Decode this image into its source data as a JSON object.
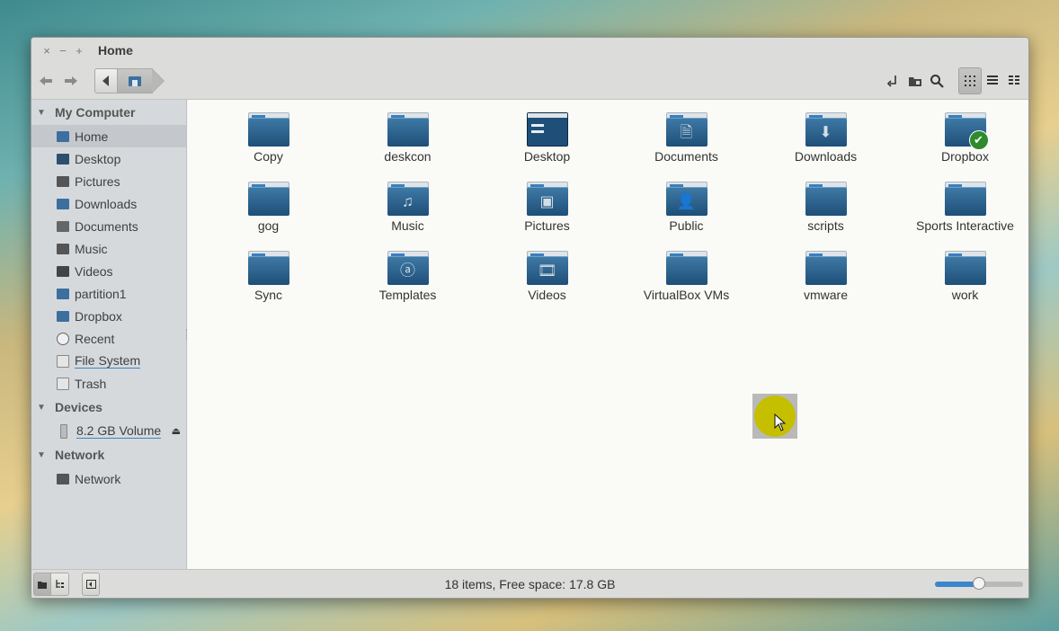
{
  "window": {
    "title": "Home"
  },
  "titlebar": {
    "close": "×",
    "minimize": "−",
    "maximize": "+"
  },
  "toolbar": {
    "back": "◀",
    "forward": "▶",
    "path_prev": "◀"
  },
  "sidebar": {
    "sections": [
      {
        "title": "My Computer",
        "items": [
          {
            "label": "Home",
            "icon": "home-icon",
            "selected": true
          },
          {
            "label": "Desktop",
            "icon": "desktop-icon"
          },
          {
            "label": "Pictures",
            "icon": "pictures-icon"
          },
          {
            "label": "Downloads",
            "icon": "downloads-icon"
          },
          {
            "label": "Documents",
            "icon": "documents-icon"
          },
          {
            "label": "Music",
            "icon": "music-icon"
          },
          {
            "label": "Videos",
            "icon": "videos-icon"
          },
          {
            "label": "partition1",
            "icon": "folder-icon"
          },
          {
            "label": "Dropbox",
            "icon": "folder-icon"
          },
          {
            "label": "Recent",
            "icon": "recent-icon"
          },
          {
            "label": "File System",
            "icon": "drive-icon"
          },
          {
            "label": "Trash",
            "icon": "trash-icon"
          }
        ]
      },
      {
        "title": "Devices",
        "items": [
          {
            "label": "8.2 GB Volume",
            "icon": "usb-drive-icon"
          }
        ]
      },
      {
        "title": "Network",
        "items": [
          {
            "label": "Network",
            "icon": "network-icon"
          }
        ]
      }
    ]
  },
  "files": [
    {
      "label": "Copy",
      "icon": "folder"
    },
    {
      "label": "deskcon",
      "icon": "folder"
    },
    {
      "label": "Desktop",
      "icon": "desktop"
    },
    {
      "label": "Documents",
      "icon": "documents"
    },
    {
      "label": "Downloads",
      "icon": "downloads"
    },
    {
      "label": "Dropbox",
      "icon": "dropbox"
    },
    {
      "label": "gog",
      "icon": "folder"
    },
    {
      "label": "Music",
      "icon": "music"
    },
    {
      "label": "Pictures",
      "icon": "pictures"
    },
    {
      "label": "Public",
      "icon": "public"
    },
    {
      "label": "scripts",
      "icon": "folder"
    },
    {
      "label": "Sports Interactive",
      "icon": "folder"
    },
    {
      "label": "Sync",
      "icon": "folder"
    },
    {
      "label": "Templates",
      "icon": "templates"
    },
    {
      "label": "Videos",
      "icon": "videos"
    },
    {
      "label": "VirtualBox VMs",
      "icon": "folder"
    },
    {
      "label": "vmware",
      "icon": "folder"
    },
    {
      "label": "work",
      "icon": "folder"
    }
  ],
  "status": {
    "text": "18 items, Free space: 17.8 GB",
    "zoom_level": 0.5
  },
  "colors": {
    "accent": "#3b86cc",
    "folder": "#2a5f8c",
    "cursor_highlight": "#c6bf00"
  }
}
